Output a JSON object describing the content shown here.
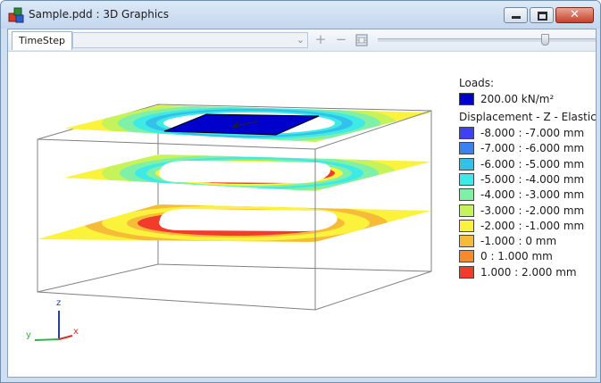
{
  "window": {
    "title": "Sample.pdd : 3D Graphics",
    "close_glyph": "✕"
  },
  "toolbar": {
    "tab_label": "TimeStep",
    "combo_value": "",
    "icons": [
      "plus-icon",
      "minus-icon",
      "film-icon"
    ]
  },
  "legend": {
    "loads_title": "Loads:",
    "load_item": {
      "color": "#0000cc",
      "label": "200.00 kN/m²"
    },
    "displacement_title": "Displacement - Z - Elastic",
    "items": [
      {
        "color": "#3f3ff5",
        "label": "-8.000 : -7.000 mm"
      },
      {
        "color": "#3a82f0",
        "label": "-7.000 : -6.000 mm"
      },
      {
        "color": "#33c0ea",
        "label": "-6.000 : -5.000 mm"
      },
      {
        "color": "#3eeae6",
        "label": "-5.000 : -4.000 mm"
      },
      {
        "color": "#7ff0a8",
        "label": "-4.000 : -3.000 mm"
      },
      {
        "color": "#c6f25a",
        "label": "-3.000 : -2.000 mm"
      },
      {
        "color": "#fbf23b",
        "label": "-2.000 : -1.000 mm"
      },
      {
        "color": "#f7bb3a",
        "label": "-1.000 : 0 mm"
      },
      {
        "color": "#f58a2f",
        "label": "0 : 1.000 mm"
      },
      {
        "color": "#f23b2b",
        "label": "1.000 : 2.000 mm"
      }
    ]
  },
  "axes": {
    "z": "z",
    "y": "y",
    "x": "x"
  }
}
